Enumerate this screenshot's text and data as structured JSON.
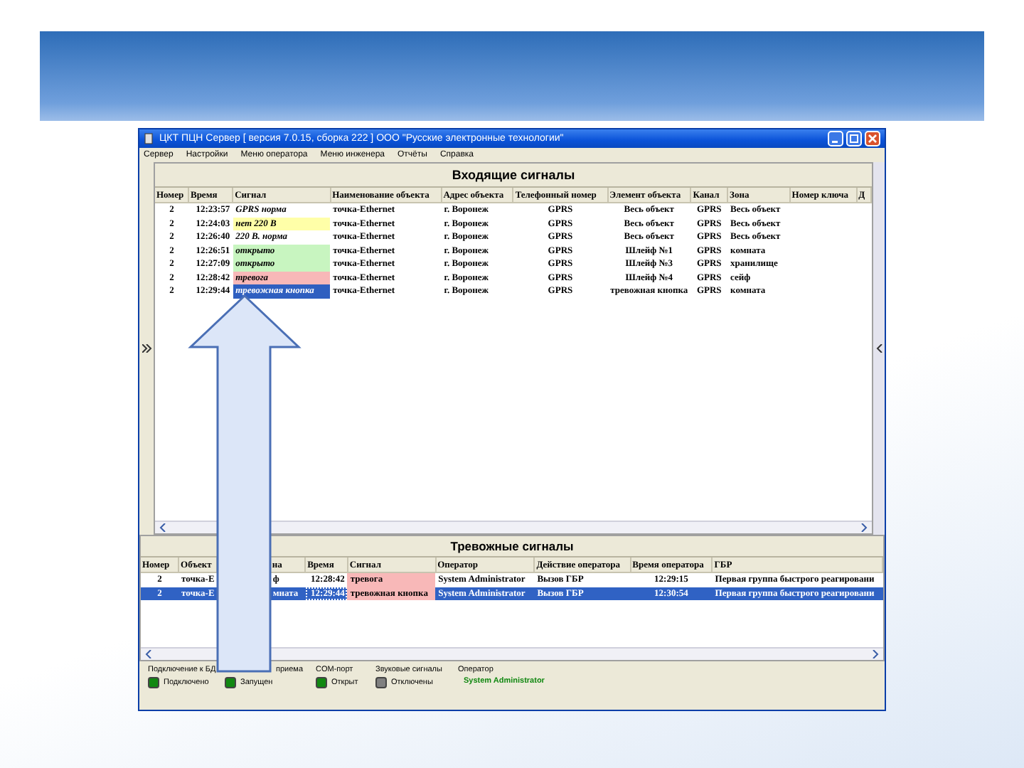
{
  "window": {
    "title": "ЦКТ ПЦН Сервер [ версия 7.0.15, сборка 222 ] ООО \"Русские электронные технологии\""
  },
  "menu": [
    "Сервер",
    "Настройки",
    "Меню оператора",
    "Меню инженера",
    "Отчёты",
    "Справка"
  ],
  "incoming": {
    "title": "Входящие сигналы",
    "columns": [
      "Номер",
      "Время",
      "Сигнал",
      "Наименование объекта",
      "Адрес объекта",
      "Телефонный номер",
      "Элемент объекта",
      "Канал",
      "Зона",
      "Номер ключа",
      "Д"
    ],
    "rows": [
      {
        "color": "#ffffff",
        "cells": [
          "2",
          "12:23:57",
          "GPRS норма",
          "точка-Ethernet",
          "г. Воронеж",
          "GPRS",
          "Весь объект",
          "GPRS",
          "Весь объект"
        ]
      },
      {
        "color": "#ffffa8",
        "cells": [
          "2",
          "12:24:03",
          "нет 220 В",
          "точка-Ethernet",
          "г. Воронеж",
          "GPRS",
          "Весь объект",
          "GPRS",
          "Весь объект"
        ]
      },
      {
        "color": "#ffffff",
        "cells": [
          "2",
          "12:26:40",
          "220 В. норма",
          "точка-Ethernet",
          "г. Воронеж",
          "GPRS",
          "Весь объект",
          "GPRS",
          "Весь объект"
        ]
      },
      {
        "color": "#c8f5c0",
        "cells": [
          "2",
          "12:26:51",
          "открыто",
          "точка-Ethernet",
          "г. Воронеж",
          "GPRS",
          "Шлейф №1",
          "GPRS",
          "комната"
        ]
      },
      {
        "color": "#c8f5c0",
        "cells": [
          "2",
          "12:27:09",
          "открыто",
          "точка-Ethernet",
          "г. Воронеж",
          "GPRS",
          "Шлейф №3",
          "GPRS",
          "хранилище"
        ]
      },
      {
        "color": "#f8b8b8",
        "cells": [
          "2",
          "12:28:42",
          "тревога",
          "точка-Ethernet",
          "г. Воронеж",
          "GPRS",
          "Шлейф №4",
          "GPRS",
          "сейф"
        ]
      },
      {
        "color": "#2f5fc0",
        "cells": [
          "2",
          "12:29:44",
          "тревожная кнопка",
          "точка-Ethernet",
          "г. Воронеж",
          "GPRS",
          "тревожная кнопка",
          "GPRS",
          "комната"
        ]
      }
    ]
  },
  "alarms": {
    "title": "Тревожные сигналы",
    "columns": [
      "Номер",
      "Объект",
      "на",
      "Время",
      "Сигнал",
      "Оператор",
      "Действие оператора",
      "Время оператора",
      "ГБР"
    ],
    "rows": [
      {
        "selected": false,
        "color": "#f8b8b8",
        "cells": [
          "2",
          "точка-Е",
          "ф",
          "12:28:42",
          "тревога",
          "System Administrator",
          "Вызов ГБР",
          "12:29:15",
          "Первая группа быстрого реагировани"
        ]
      },
      {
        "selected": true,
        "color": "#f8b8b8",
        "cells": [
          "2",
          "точка-Е",
          "мната",
          "12:29:44",
          "тревожная кнопка",
          "System Administrator",
          "Вызов ГБР",
          "12:30:54",
          "Первая группа быстрого реагировани"
        ]
      }
    ]
  },
  "status_bar": [
    {
      "kind": "led",
      "label": "Подключение к БД",
      "color": "#118811",
      "state": "Подключено"
    },
    {
      "kind": "led",
      "label": "приема",
      "color": "#118811",
      "state": "Запущен"
    },
    {
      "kind": "led",
      "label": "COM-порт",
      "color": "#118811",
      "state": "Открыт"
    },
    {
      "kind": "led",
      "label": "Звуковые сигналы",
      "color": "#808080",
      "state": "Отключены"
    },
    {
      "kind": "text",
      "label": "Оператор",
      "value": "System Administrator"
    }
  ]
}
